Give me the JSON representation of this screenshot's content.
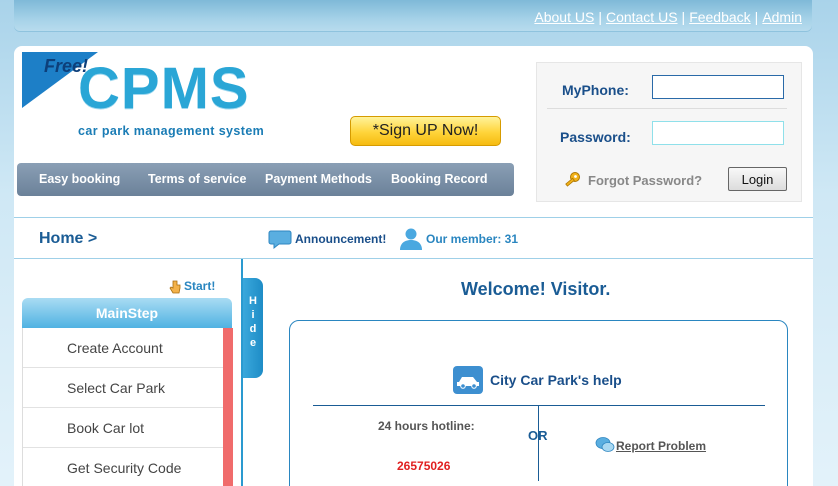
{
  "toplinks": {
    "about": "About US",
    "contact": "Contact US",
    "feedback": "Feedback",
    "admin": "Admin",
    "separator": "|"
  },
  "logo": {
    "free": "Free!",
    "name": "CPMS",
    "tagline": "car park management system"
  },
  "signup": {
    "label": "*Sign UP Now!"
  },
  "nav": {
    "items": [
      "Easy booking",
      "Terms of service",
      "Payment Methods",
      "Booking Record"
    ]
  },
  "login": {
    "phone_label": "MyPhone:",
    "phone_value": "",
    "password_label": "Password:",
    "password_value": "",
    "forgot": "Forgot Password?",
    "login_button": "Login"
  },
  "crumb": {
    "home": "Home >",
    "announcement": "Announcement!",
    "member": "Our member: 31"
  },
  "sidebar": {
    "start": "Start!",
    "mainstep": "MainStep",
    "steps": [
      "Create Account",
      "Select Car Park",
      "Book Car lot",
      "Get Security Code"
    ],
    "hide_letters": [
      "H",
      "i",
      "d",
      "e"
    ]
  },
  "main": {
    "welcome": "Welcome! Visitor.",
    "help_title": "City Car Park's help",
    "hotline_label": "24 hours hotline:",
    "hotline_number": "26575026",
    "or": "OR",
    "report": "Report Problem"
  },
  "colors": {
    "accent": "#2a86c0",
    "step_marker": "#f06b6b",
    "signup": "#ffd43a"
  }
}
